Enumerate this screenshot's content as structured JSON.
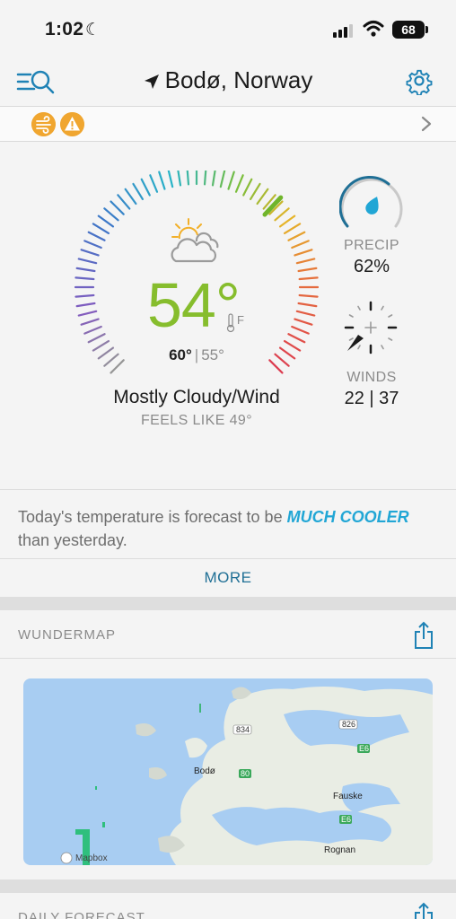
{
  "status_bar": {
    "time": "1:02",
    "battery": "68"
  },
  "header": {
    "location": "Bodø, Norway"
  },
  "alerts": {
    "icons": [
      "wind-alert-icon",
      "warning-icon"
    ]
  },
  "current": {
    "temperature": "54°",
    "unit": "F",
    "high": "60°",
    "low": "55°",
    "condition": "Mostly Cloudy/Wind",
    "feels_like": "FEELS LIKE 49°",
    "precip_label": "PRECIP",
    "precip_value": "62%",
    "winds_label": "WINDS",
    "winds_value": "22 | 37"
  },
  "summary": {
    "prefix": "Today's temperature is forecast to be ",
    "highlight": "MUCH COOLER",
    "suffix": " than yesterday."
  },
  "more_label": "MORE",
  "wundermap": {
    "title": "WUNDERMAP",
    "labels": [
      "Bodø",
      "Fauske",
      "Rognan",
      "834",
      "826",
      "80",
      "E6",
      "E6"
    ],
    "attribution": "Mapbox"
  },
  "daily_forecast": {
    "title": "DAILY FORECAST"
  },
  "colors": {
    "accent": "#21a6d5",
    "temp": "#86bd2d",
    "alert": "#f0a630",
    "link": "#1f6f95"
  }
}
